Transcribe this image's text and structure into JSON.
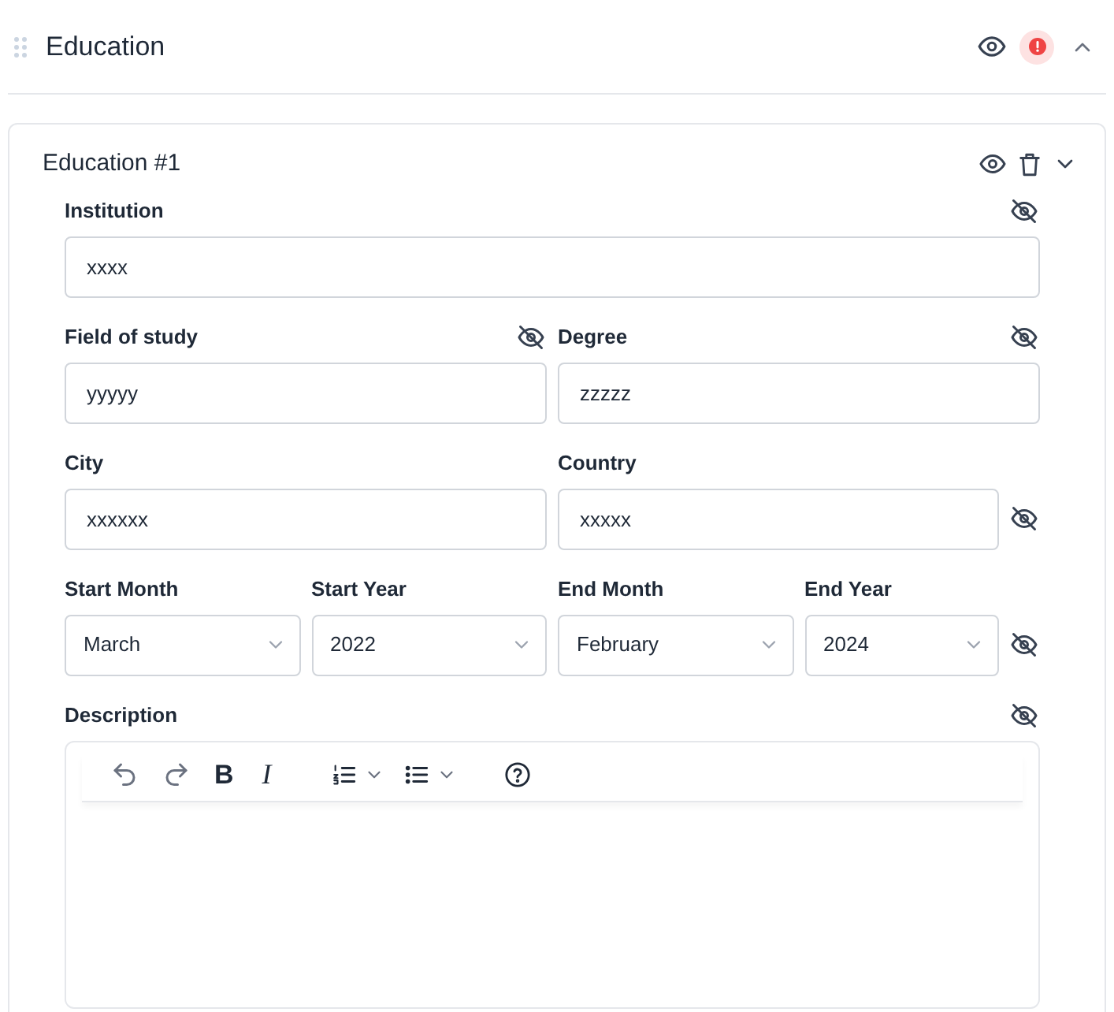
{
  "section": {
    "title": "Education"
  },
  "entry": {
    "title": "Education #1"
  },
  "rows": [
    {
      "fields": [
        {
          "kind": "text",
          "label": "Institution",
          "value": "xxxx",
          "toggle_by_label": true
        }
      ]
    },
    {
      "fields": [
        {
          "kind": "text",
          "label": "Field of study",
          "value": "yyyyy",
          "toggle_by_label": true
        },
        {
          "kind": "text",
          "label": "Degree",
          "value": "zzzzz",
          "toggle_by_label": true
        }
      ]
    },
    {
      "fields": [
        {
          "kind": "text",
          "label": "City",
          "value": "xxxxxx"
        },
        {
          "kind": "text",
          "label": "Country",
          "value": "xxxxx",
          "toggle_by_input": true
        }
      ]
    },
    {
      "fields": [
        {
          "kind": "select",
          "label": "Start Month",
          "value": "March"
        },
        {
          "kind": "select",
          "label": "Start Year",
          "value": "2022"
        },
        {
          "kind": "select",
          "label": "End Month",
          "value": "February"
        },
        {
          "kind": "select",
          "label": "End Year",
          "value": "2024",
          "toggle_by_input": true
        }
      ]
    },
    {
      "fields": [
        {
          "kind": "editor",
          "label": "Description",
          "toggle_by_label": true,
          "toolbar": [
            {
              "kind": "undo"
            },
            {
              "kind": "redo"
            },
            {
              "kind": "bold",
              "label": "B"
            },
            {
              "kind": "italic",
              "label": "I"
            },
            {
              "kind": "ordered-list"
            },
            {
              "kind": "bullet-list"
            },
            {
              "kind": "help"
            }
          ]
        }
      ]
    }
  ]
}
